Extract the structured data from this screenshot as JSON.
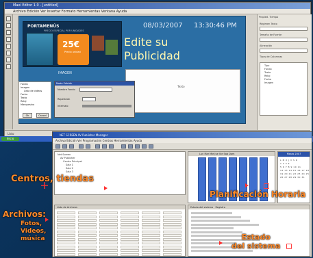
{
  "editor": {
    "title": "Maxi Editor 1.0 - [untitled]",
    "menu": "Archivo  Edición  Ver  Insertar  Formato  Herramientas  Ventana  Ayuda",
    "banner_title": "PORTAMENÚS",
    "banner_sub": "PRECIO ESPECIAL POR UNIDADES",
    "banner_price": "25€",
    "banner_price_sub": "Precio unidad",
    "image_label": "IMAGEN",
    "date": "08/03/2007",
    "time": "13:30:46 PM",
    "headline_line1": "Edite su",
    "headline_line2": "Publicidad",
    "white_text": "Texto",
    "tree_items": [
      "Fondo",
      "Imagen",
      "Lista de videos",
      "Fecha",
      "Texto",
      "Reloj",
      "Marquesina"
    ],
    "dialog_title": "Modo Edición",
    "dialog_row1": "Nombre Fondo",
    "dialog_row2": "Repetición",
    "dialog_row3": "Intervalo",
    "ok_label": "Ok",
    "cancel_label": "Cancel",
    "right_tabs": "Propied.  Tiempo",
    "right_labels": [
      "Régimen Texto",
      "Tamaño de Fuente",
      "Alineación",
      "Tipos de Columnas"
    ],
    "right_list": [
      "Tipo",
      "Fondo",
      "Texto",
      "Reloj",
      "Fecha",
      "Imagen"
    ],
    "status_text": "Listo"
  },
  "taskbar": {
    "start_label": "Inicio"
  },
  "manager": {
    "title": "NET SCREEN AV Publisher Manager",
    "menu": "Archivo  Edición  Ver  Programación  Centros  Herramientas  Ayuda",
    "tree_lines": [
      "Net Screen",
      "AV Publisher",
      "Centro Principal",
      "Sala 1",
      "Sala 2",
      "Sala 3"
    ],
    "sched_header": "Lun  Mar  Mie  Jue  Vie  Sab  Dom",
    "calendar_header": "Marzo 2007",
    "calendar_rows": [
      "L M X J V S D",
      "  1 2 3 4",
      "5 6 7 8 9 10 11",
      "12 13 14 15 16 17 18",
      "19 20 21 22 23 24 25",
      "26 27 28 29 30 31"
    ],
    "files_header": "Lista de Archivos",
    "status_header": "Estado del sistema  ·  Registro"
  },
  "annotations": {
    "centros": "Centros, tiendas",
    "planificacion": "Planificación Horaria",
    "archivos": "Archivos:",
    "archivos_sub": [
      "Fotos,",
      "Videos,",
      "música"
    ],
    "estado_line1": "Estado",
    "estado_line2": "del sistema"
  },
  "colors": {
    "annotation": "#ff8a2a",
    "schedule": "#3f6fcf",
    "canvas": "#2b6ea4"
  }
}
